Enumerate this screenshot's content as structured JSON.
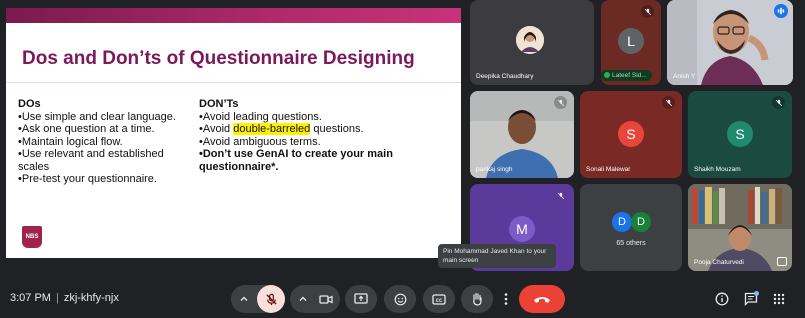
{
  "slide": {
    "title": "Dos and Don’ts of Questionnaire Designing",
    "dos": {
      "heading": "DOs",
      "items": [
        "•Use simple and clear language.",
        "•Ask one question at a time.",
        "•Maintain logical flow.",
        "•Use relevant and established scales",
        "•Pre-test your questionnaire."
      ]
    },
    "donts": {
      "heading": "DON’Ts",
      "item1": "•Avoid leading questions.",
      "item2_prefix": "•Avoid ",
      "item2_highlight": "double-barreled",
      "item2_suffix": " questions.",
      "item3": "•Avoid ambiguous terms.",
      "item4": "•Don’t use GenAI to create your main questionnaire*."
    },
    "logo_text": "NBS"
  },
  "participants": {
    "deepika": {
      "name": "Deepika Chaudhary"
    },
    "lateef": {
      "name": "Lateef Sid...",
      "initial": "L"
    },
    "anish": {
      "name": "Anish Y"
    },
    "pankaj": {
      "name": "pankaj singh"
    },
    "sonali": {
      "name": "Sonali Malewar",
      "initial": "S"
    },
    "shaikh": {
      "name": "Shaikh Mouzam",
      "initial": "S"
    },
    "m": {
      "initial": "M"
    },
    "others": {
      "initial1": "D",
      "initial2": "D",
      "label": "65 others"
    },
    "pooja": {
      "name": "Pooja Chaturvedi"
    }
  },
  "tooltip": "Pin Mohammad Javed Khan to your main screen",
  "bottom_bar": {
    "time": "3:07 PM",
    "separator": "|",
    "meeting_code": "zkj-khfy-njx"
  },
  "icons": {
    "mic": "mic-off-icon",
    "camera": "videocam-icon",
    "present": "present-screen-icon",
    "emoji": "emoji-icon",
    "captions": "closed-caption-icon",
    "hand": "raise-hand-icon",
    "more": "more-vert-icon",
    "end": "call-end-icon",
    "info": "info-icon",
    "chat": "chat-icon",
    "apps": "apps-grid-icon"
  },
  "colors": {
    "end_call": "#ea4335",
    "mic_off_bg": "#f9dedc",
    "slide_title": "#7a1a5c",
    "highlight": "#fff200"
  }
}
